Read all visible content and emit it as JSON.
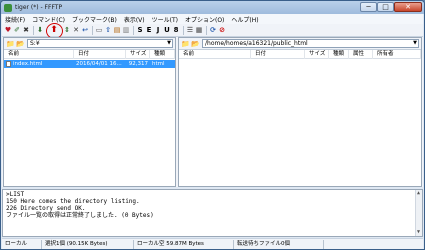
{
  "window": {
    "title": "tiger (*) - FFFTP",
    "close_glyph": "✕",
    "min_glyph": "─",
    "max_glyph": "□"
  },
  "menu": [
    "接続(F)",
    "コマンド(C)",
    "ブックマーク(B)",
    "表示(V)",
    "ツール(T)",
    "オプション(O)",
    "ヘルプ(H)"
  ],
  "toolbar": {
    "icons": [
      {
        "name": "connect-icon",
        "glyph": "♥",
        "color": "#c0182b"
      },
      {
        "name": "quick-connect-icon",
        "glyph": "✐",
        "color": "#2b6e2b"
      },
      {
        "name": "disconnect-icon",
        "glyph": "✖",
        "color": "#333333"
      },
      {
        "name": "download-icon",
        "glyph": "⬇",
        "color": "#2b6e2b"
      },
      {
        "name": "upload-icon",
        "glyph": "⬆",
        "color": "#cc0000"
      },
      {
        "name": "mirror-upload-icon",
        "glyph": "⇕",
        "color": "#2b6e2b"
      },
      {
        "name": "delete-icon",
        "glyph": "✕",
        "color": "#333333"
      },
      {
        "name": "rename-icon",
        "glyph": "↩",
        "color": "#2a5fb0"
      },
      {
        "name": "mkdir-icon",
        "glyph": "▭",
        "color": "#555555"
      },
      {
        "name": "parent-dir-icon",
        "glyph": "⇧",
        "color": "#2a5fb0"
      },
      {
        "name": "bookmark-icon",
        "glyph": "▤",
        "color": "#b06000"
      },
      {
        "name": "chmod-icon",
        "glyph": "▥",
        "color": "#777777"
      },
      {
        "name": "kanji-sjis-icon",
        "glyph": "S",
        "color": "#000000"
      },
      {
        "name": "kanji-euc-icon",
        "glyph": "E",
        "color": "#000000"
      },
      {
        "name": "kanji-jis-icon",
        "glyph": "J",
        "color": "#000000"
      },
      {
        "name": "kanji-utf8-icon",
        "glyph": "U",
        "color": "#000000"
      },
      {
        "name": "kanji-none-icon",
        "glyph": "8",
        "color": "#000000"
      },
      {
        "name": "list-view-icon",
        "glyph": "☰",
        "color": "#444444"
      },
      {
        "name": "detail-view-icon",
        "glyph": "▦",
        "color": "#444444"
      },
      {
        "name": "refresh-icon",
        "glyph": "⟳",
        "color": "#2a5fb0"
      },
      {
        "name": "stop-icon",
        "glyph": "⊘",
        "color": "#cc0000"
      }
    ]
  },
  "local": {
    "path": "S:¥",
    "columns": [
      "名前",
      "日付",
      "サイズ",
      "種類"
    ],
    "files": [
      {
        "name": "index.html",
        "date": "2016/04/01 16...",
        "size": "92,317",
        "type": "html",
        "selected": true
      }
    ]
  },
  "remote": {
    "path": "/home/homes/a16321/public_html",
    "columns": [
      "名前",
      "日付",
      "サイズ",
      "種類",
      "属性",
      "所有者"
    ],
    "files": []
  },
  "log": [
    ">LIST",
    "150 Here comes the directory listing.",
    "226 Directory send OK.",
    "ファイル一覧の取得は正常終了しました. (0 Bytes)"
  ],
  "status": {
    "local_label": "ローカル",
    "selected": "選択1個 (90.15K Bytes)",
    "free": "ローカル空 59.87M Bytes",
    "queue": "転送待ちファイル0個"
  },
  "colors": {
    "selection": "#3399ff",
    "titlebar": "#b9d0ea",
    "highlight_ring": "#d10000"
  }
}
